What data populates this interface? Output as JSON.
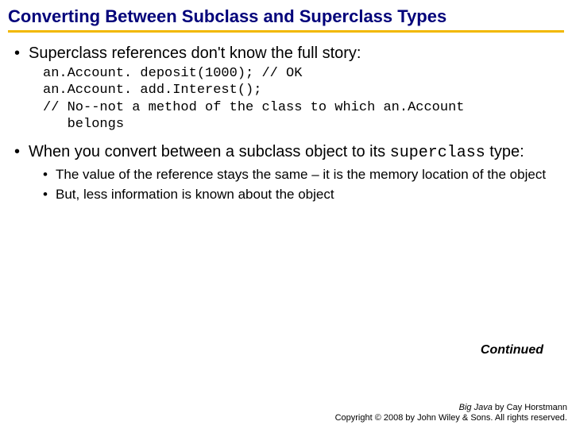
{
  "title": "Converting Between Subclass and Superclass Types",
  "bullets": {
    "b1": "Superclass references don't know the full story:",
    "code": "an.Account. deposit(1000); // OK\nan.Account. add.Interest();\n// No--not a method of the class to which an.Account\n   belongs",
    "b2_pre": "When you convert between a subclass object to its ",
    "b2_mono": "superclass",
    "b2_post": " type:",
    "sub1": "The value of the reference stays the same – it is the memory location of the object",
    "sub2": "But, less information is known about the object"
  },
  "continued": "Continued",
  "footer": {
    "book": "Big Java",
    "by": " by Cay Horstmann",
    "copyright": "Copyright © 2008 by John Wiley & Sons. All rights reserved."
  }
}
